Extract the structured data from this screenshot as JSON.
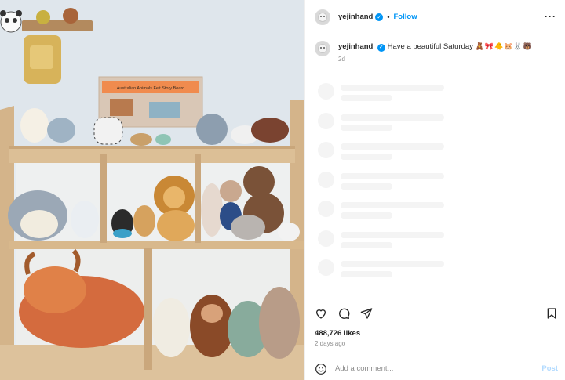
{
  "photo": {
    "book_title": "Australian Animals Felt Story Board"
  },
  "header": {
    "username": "yejinhand",
    "verified_icon": "check-badge-icon",
    "dot": "•",
    "follow_label": "Follow",
    "more_label": "···"
  },
  "caption": {
    "username": "yejinhand",
    "text": "Have a beautiful Saturday",
    "emojis": "🧸🎀🐥🐹🐰🐻",
    "age": "2d"
  },
  "actions": {
    "like_icon": "heart-icon",
    "comment_icon": "comment-icon",
    "share_icon": "paper-plane-icon",
    "save_icon": "bookmark-icon"
  },
  "stats": {
    "likes": "488,726 likes",
    "posted": "2 days ago"
  },
  "comment_box": {
    "emoji_icon": "smiley-icon",
    "placeholder": "Add a comment...",
    "post_label": "Post"
  },
  "colors": {
    "accent": "#0095f6",
    "post_disabled": "#b3dbff",
    "muted": "#8e8e8e"
  }
}
